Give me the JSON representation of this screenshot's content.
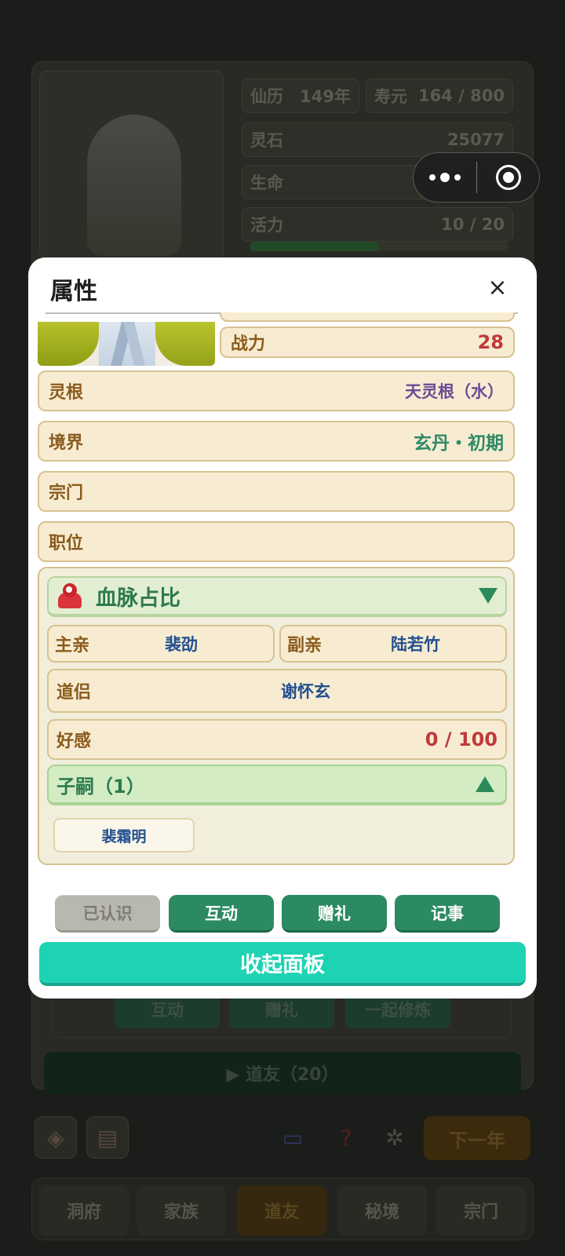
{
  "background": {
    "stats": {
      "calendar_label": "仙历",
      "calendar_value": "149年",
      "lifespan_label": "寿元",
      "lifespan_value": "164 / 800",
      "spirit_stone_label": "灵石",
      "spirit_stone_value": "25077",
      "life_label": "生命",
      "vitality_label": "活力",
      "vitality_value": "10 / 20"
    },
    "vitality_fraction": 0.5,
    "action_buttons": [
      "互动",
      "赠礼",
      "一起修炼"
    ],
    "friends_button": "▶ 道友（20）",
    "next_year_button": "下一年",
    "tabs": [
      "洞府",
      "家族",
      "道友",
      "秘境",
      "宗门"
    ],
    "active_tab": "道友"
  },
  "modal": {
    "title": "属性",
    "close_icon": "×",
    "power_label": "战力",
    "power_value": "28",
    "spirit_root_label": "灵根",
    "spirit_root_value": "天灵根（水）",
    "realm_label": "境界",
    "realm_value": "玄丹・初期",
    "sect_label": "宗门",
    "sect_value": "",
    "position_label": "职位",
    "position_value": "",
    "bloodline": {
      "title": "血脉占比",
      "main_parent_label": "主亲",
      "main_parent_value": "裴劭",
      "sub_parent_label": "副亲",
      "sub_parent_value": "陆若竹",
      "partner_label": "道侣",
      "partner_value": "谢怀玄",
      "affection_label": "好感",
      "affection_value": "0 / 100",
      "children_label": "子嗣（1）",
      "children": [
        "裴霜明"
      ]
    },
    "actions": {
      "known": "已认识",
      "interact": "互动",
      "gift": "赠礼",
      "record": "记事"
    },
    "collapse_button": "收起面板"
  },
  "colors": {
    "label": "#8a5b1c",
    "power_value": "#c0393b",
    "spirit_root_value": "#6a4c93",
    "realm_value": "#2f8a66",
    "name_value": "#23508f",
    "affection_value": "#c0393b",
    "primary_button": "#2c8a63",
    "collapse_button": "#1ed3b3"
  }
}
